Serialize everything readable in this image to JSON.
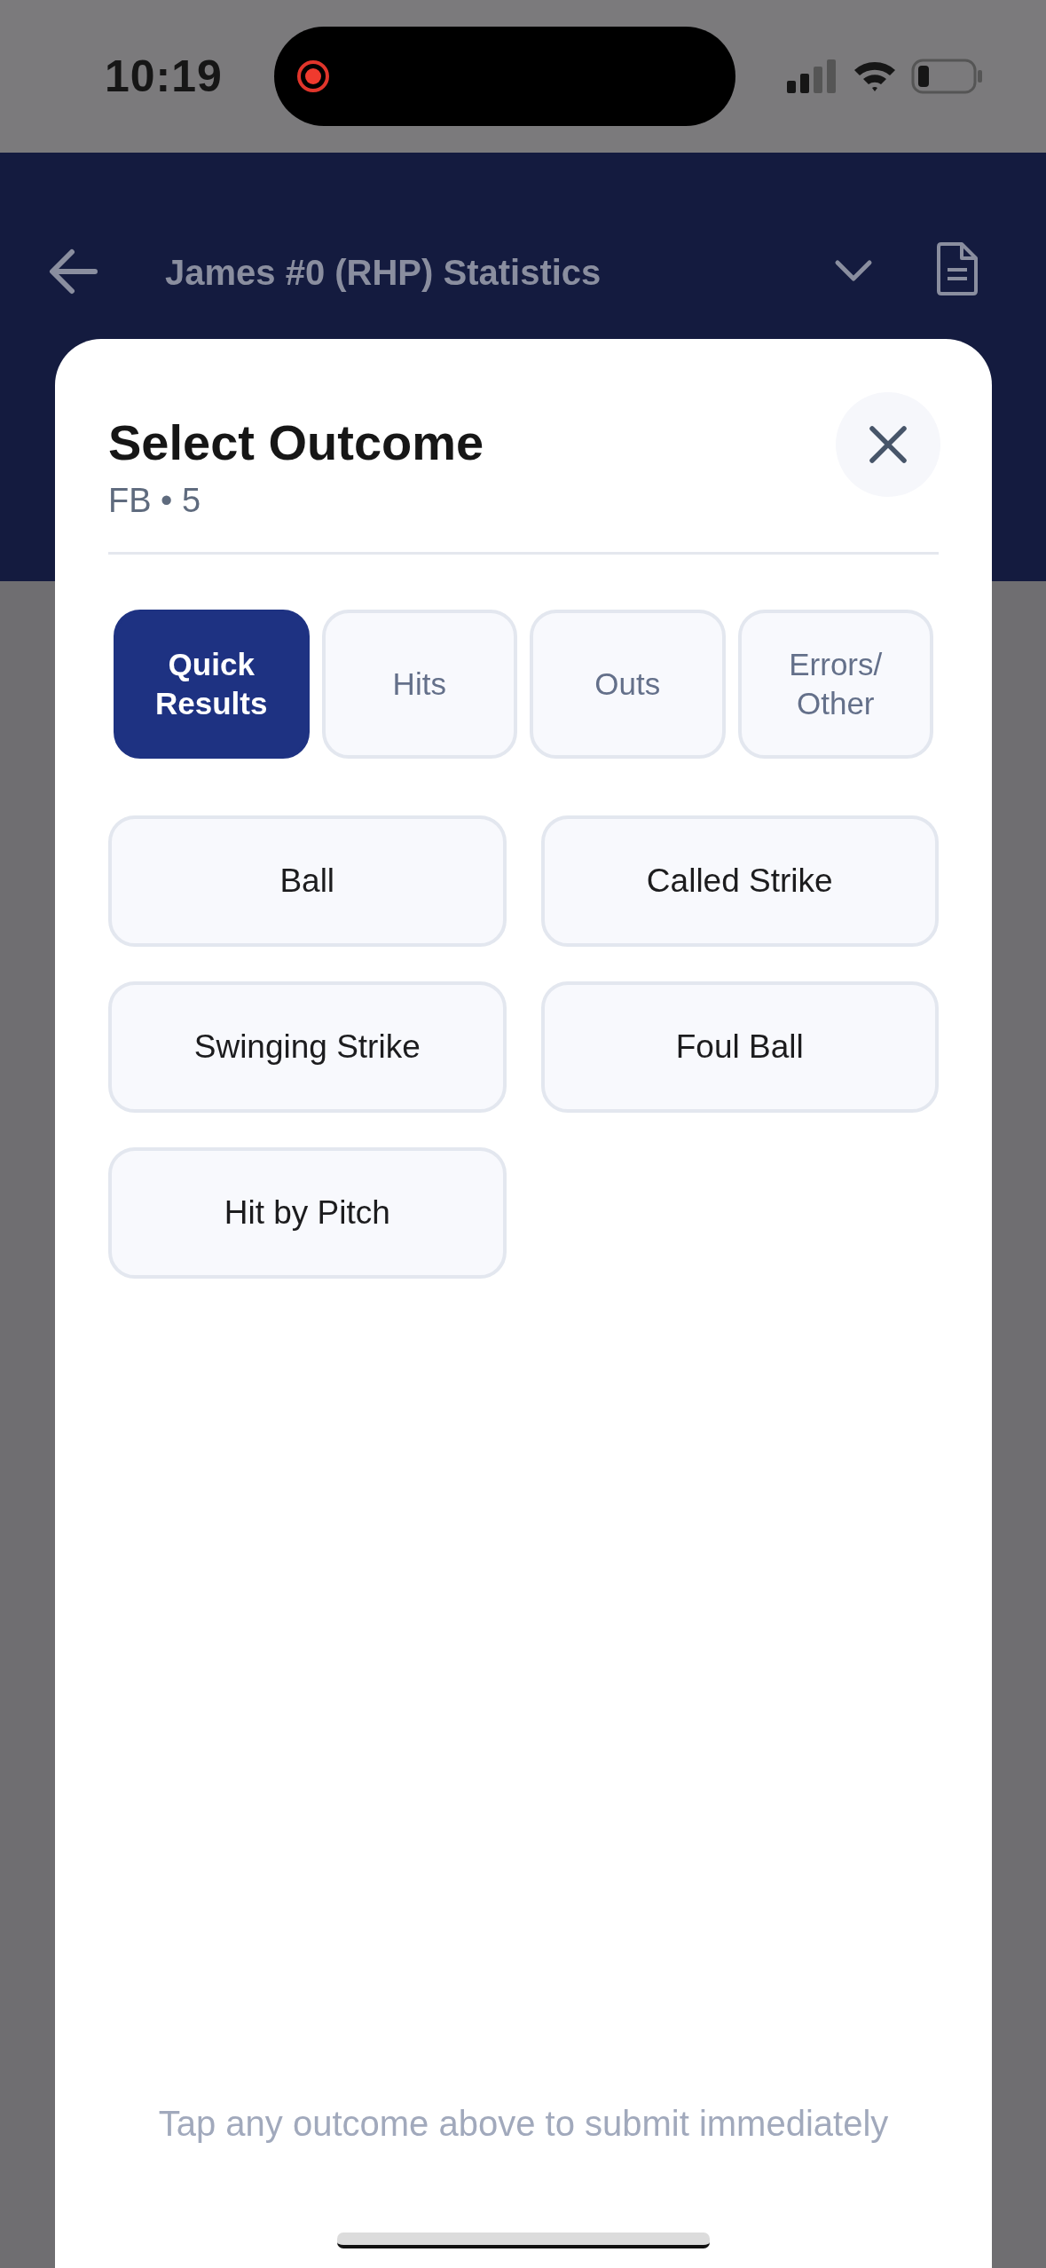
{
  "status_bar": {
    "time": "10:19",
    "recording": true
  },
  "header": {
    "title": "James #0 (RHP) Statistics"
  },
  "modal": {
    "title": "Select Outcome",
    "subtitle": "FB • 5",
    "tabs": [
      {
        "label": "Quick\nResults",
        "selected": true
      },
      {
        "label": "Hits",
        "selected": false
      },
      {
        "label": "Outs",
        "selected": false
      },
      {
        "label": "Errors/\nOther",
        "selected": false
      }
    ],
    "outcomes": [
      "Ball",
      "Called Strike",
      "Swinging Strike",
      "Foul Ball",
      "Hit by Pitch"
    ],
    "hint": "Tap any outcome above to submit immediately"
  }
}
